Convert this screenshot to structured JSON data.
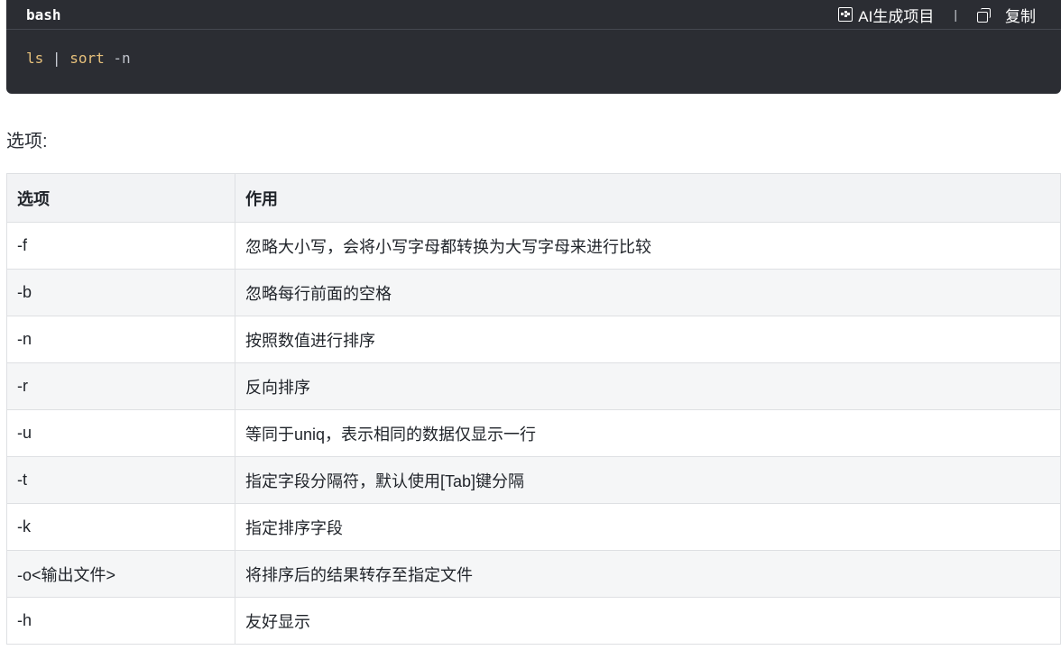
{
  "code_block": {
    "language": "bash",
    "actions": {
      "ai_label": "AI生成项目",
      "copy_label": "复制"
    },
    "code": {
      "cmd1": "ls",
      "pipe": "|",
      "cmd2": "sort",
      "flag": "-n"
    }
  },
  "options_label": "选项:",
  "table": {
    "headers": [
      "选项",
      "作用"
    ],
    "rows": [
      {
        "option": "-f",
        "desc": "忽略大小写，会将小写字母都转换为大写字母来进行比较"
      },
      {
        "option": "-b",
        "desc": "忽略每行前面的空格"
      },
      {
        "option": "-n",
        "desc": "按照数值进行排序"
      },
      {
        "option": "-r",
        "desc": "反向排序"
      },
      {
        "option": "-u",
        "desc": "等同于uniq，表示相同的数据仅显示一行"
      },
      {
        "option": "-t",
        "desc": "指定字段分隔符，默认使用[Tab]键分隔"
      },
      {
        "option": "-k",
        "desc": "指定排序字段"
      },
      {
        "option": "-o<输出文件>",
        "desc": "将排序后的结果转存至指定文件"
      },
      {
        "option": "-h",
        "desc": "友好显示"
      }
    ]
  }
}
